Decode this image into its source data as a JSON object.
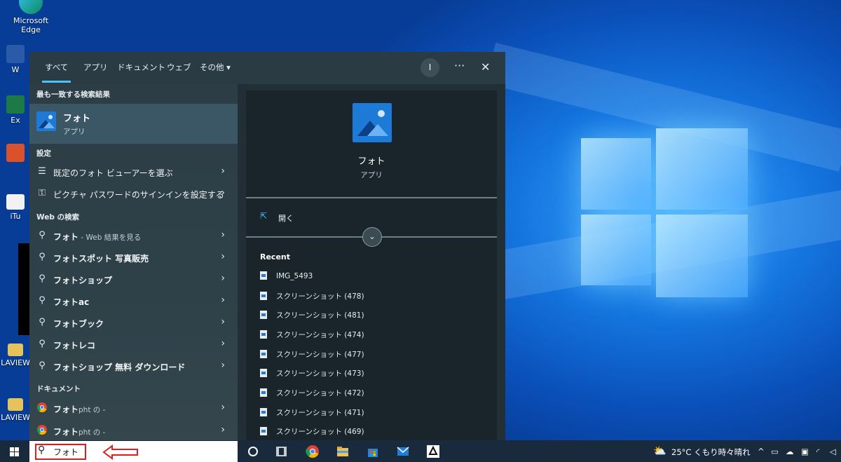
{
  "desktop": {
    "icons": [
      {
        "label": "Microsoft Edge"
      },
      {
        "label": "W"
      },
      {
        "label": "Ex"
      },
      {
        "label": "iTu"
      },
      {
        "label": "LAVIEW"
      },
      {
        "label": "LAVIEW"
      }
    ]
  },
  "search_panel": {
    "tabs": [
      {
        "label": "すべて",
        "active": true
      },
      {
        "label": "アプリ"
      },
      {
        "label": "ドキュメント"
      },
      {
        "label": "ウェブ"
      },
      {
        "label": "その他 ▾"
      }
    ],
    "avatar_initial": "I",
    "more_icon": "···",
    "close_icon": "✕",
    "best_match": {
      "heading": "最も一致する検索結果",
      "title": "フォト",
      "subtitle": "アプリ",
      "icon": "photos-app-icon"
    },
    "settings": {
      "heading": "設定",
      "items": [
        {
          "label": "既定のフォト ビューアーを選ぶ",
          "icon": "list-settings-icon"
        },
        {
          "label": "ピクチャ パスワードのサインインを設定する",
          "icon": "key-icon"
        }
      ]
    },
    "web": {
      "heading": "Web の検索",
      "items": [
        {
          "label": "フォト",
          "suffix": " - Web 結果を見る"
        },
        {
          "label": "フォトスポット 写真販売"
        },
        {
          "label": "フォトショップ"
        },
        {
          "label": "フォトac"
        },
        {
          "label": "フォトブック"
        },
        {
          "label": "フォトレコ"
        },
        {
          "label": "フォトショップ 無料 ダウンロード"
        }
      ]
    },
    "documents": {
      "heading": "ドキュメント",
      "items": [
        {
          "label": "フォト",
          "suffix": "pht の -"
        },
        {
          "label": "フォト",
          "suffix": "pht の -"
        }
      ]
    },
    "preview": {
      "title": "フォト",
      "subtitle": "アプリ",
      "open_label": "開く",
      "recent_heading": "Recent",
      "recent_items": [
        "IMG_5493",
        "スクリーンショット (478)",
        "スクリーンショット (481)",
        "スクリーンショット (474)",
        "スクリーンショット (477)",
        "スクリーンショット (473)",
        "スクリーンショット (472)",
        "スクリーンショット (471)",
        "スクリーンショット (469)"
      ]
    }
  },
  "taskbar": {
    "search_query": "フォト",
    "weather": "25°C  くもり時々晴れ",
    "tray_icons": [
      "chevron-up-icon",
      "onedrive-icon",
      "wifi-icon",
      "volume-icon"
    ]
  },
  "colors": {
    "accent": "#4cc2ff",
    "annotation": "#e21b1b",
    "panel_bg": "#1f2a31",
    "best_match_bg": "#3b5665",
    "taskbar_bg": "#182a3c"
  }
}
